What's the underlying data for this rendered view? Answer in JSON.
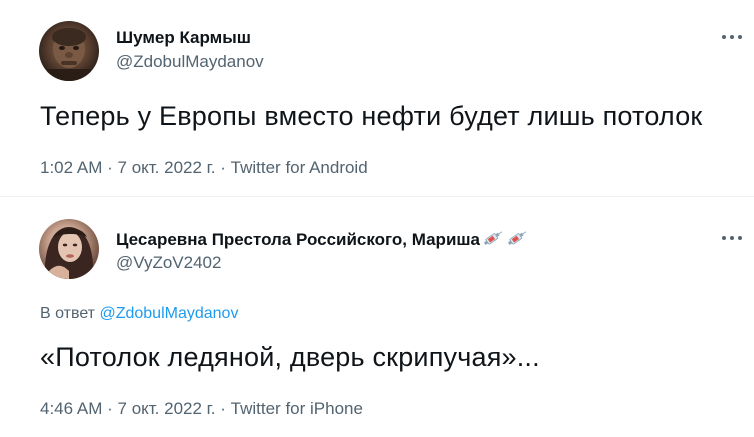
{
  "tweets": [
    {
      "author_name": "Шумер Кармыш",
      "handle": "@ZdobulMaydanov",
      "text": "Теперь у Европы вместо нефти будет лишь потолок",
      "time": "1:02 AM",
      "date": "7 окт. 2022 г.",
      "source": "Twitter for Android",
      "separator": "·"
    },
    {
      "author_name": "Цесаревна Престола Российского, Мариша",
      "name_emojis": [
        "syringe-icon",
        "syringe-icon"
      ],
      "handle": "@VyZoV2402",
      "reply_prefix": "В ответ",
      "reply_to": "@ZdobulMaydanov",
      "text": "«Потолок ледяной, дверь скрипучая»...",
      "time": "4:46 AM",
      "date": "7 окт. 2022 г.",
      "source": "Twitter for iPhone",
      "separator": "·"
    }
  ],
  "colors": {
    "text_primary": "#0f1419",
    "text_secondary": "#536471",
    "link": "#1d9bf0",
    "divider": "#eff3f4"
  }
}
